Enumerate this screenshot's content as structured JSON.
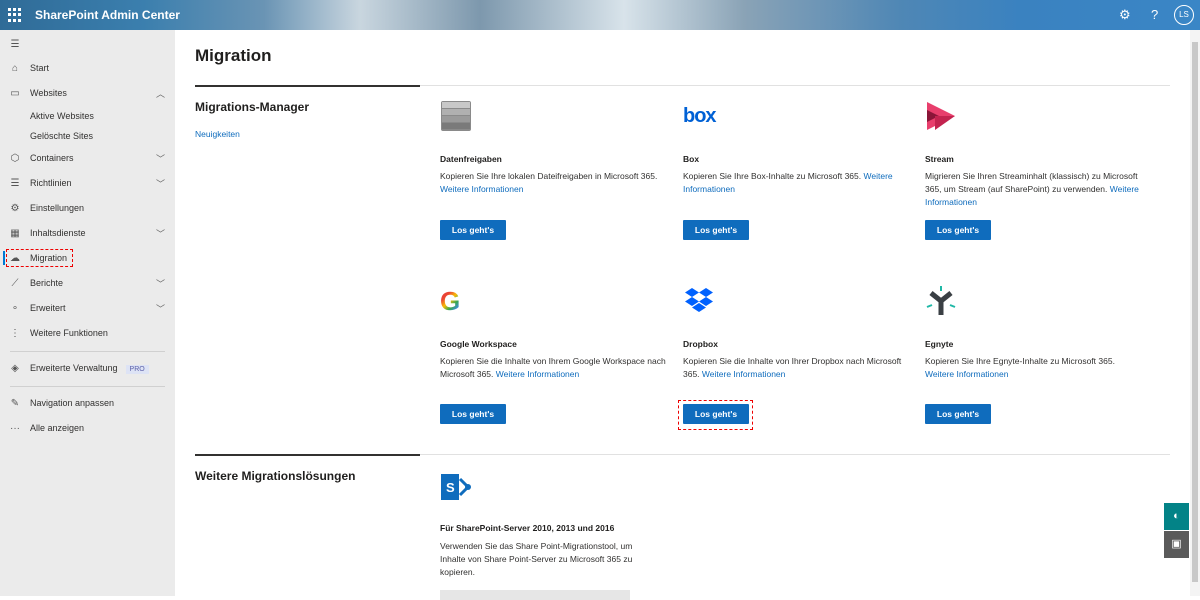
{
  "header": {
    "app_title": "SharePoint Admin Center",
    "avatar_initials": "LS"
  },
  "sidebar": {
    "items": [
      {
        "label": "Start",
        "icon": "home-icon"
      },
      {
        "label": "Websites",
        "icon": "browser-icon",
        "expanded": true,
        "children": [
          "Aktive Websites",
          "Gelöschte Sites"
        ]
      },
      {
        "label": "Containers",
        "icon": "cube-icon"
      },
      {
        "label": "Richtlinien",
        "icon": "sliders-icon"
      },
      {
        "label": "Einstellungen",
        "icon": "gear-icon"
      },
      {
        "label": "Inhaltsdienste",
        "icon": "content-icon"
      },
      {
        "label": "Migration",
        "icon": "cloud-upload-icon",
        "active": true
      },
      {
        "label": "Berichte",
        "icon": "chart-icon"
      },
      {
        "label": "Erweitert",
        "icon": "nodes-icon"
      },
      {
        "label": "Weitere Funktionen",
        "icon": "more-vertical-icon"
      },
      {
        "label": "Erweiterte Verwaltung",
        "icon": "diamond-icon",
        "badge": "PRO"
      },
      {
        "label": "Navigation anpassen",
        "icon": "pencil-icon"
      },
      {
        "label": "Alle anzeigen",
        "icon": "ellipsis-icon"
      }
    ]
  },
  "main": {
    "title": "Migration",
    "section1": {
      "title": "Migrations-Manager",
      "link": "Neuigkeiten"
    },
    "cards": [
      {
        "title": "Datenfreigaben",
        "desc": "Kopieren Sie Ihre lokalen Dateifreigaben in Microsoft 365.",
        "link": "Weitere Informationen",
        "button": "Los geht's"
      },
      {
        "title": "Box",
        "desc": "Kopieren Sie Ihre Box-Inhalte zu Microsoft 365.",
        "link": "Weitere Informationen",
        "button": "Los geht's"
      },
      {
        "title": "Stream",
        "desc": "Migrieren Sie Ihren Streaminhalt (klassisch) zu Microsoft 365, um Stream (auf SharePoint) zu verwenden.",
        "link": "Weitere Informationen",
        "button": "Los geht's"
      },
      {
        "title": "Google Workspace",
        "desc": "Kopieren Sie die Inhalte von Ihrem Google Workspace nach Microsoft 365.",
        "link": "Weitere Informationen",
        "button": "Los geht's"
      },
      {
        "title": "Dropbox",
        "desc": "Kopieren Sie die Inhalte von Ihrer Dropbox nach Microsoft 365.",
        "link": "Weitere Informationen",
        "button": "Los geht's"
      },
      {
        "title": "Egnyte",
        "desc": "Kopieren Sie Ihre Egnyte-Inhalte zu Microsoft 365.",
        "link": "Weitere Informationen",
        "button": "Los geht's"
      }
    ],
    "section2": {
      "title": "Weitere Migrationslösungen"
    },
    "sp_card": {
      "title": "Für SharePoint-Server 2010, 2013 und 2016",
      "desc": "Verwenden Sie das Share Point-Migrationstool, um Inhalte von Share Point-Server zu Microsoft 365 zu kopieren."
    }
  },
  "colors": {
    "accent": "#0f6cbd",
    "highlight": "#e00000"
  }
}
